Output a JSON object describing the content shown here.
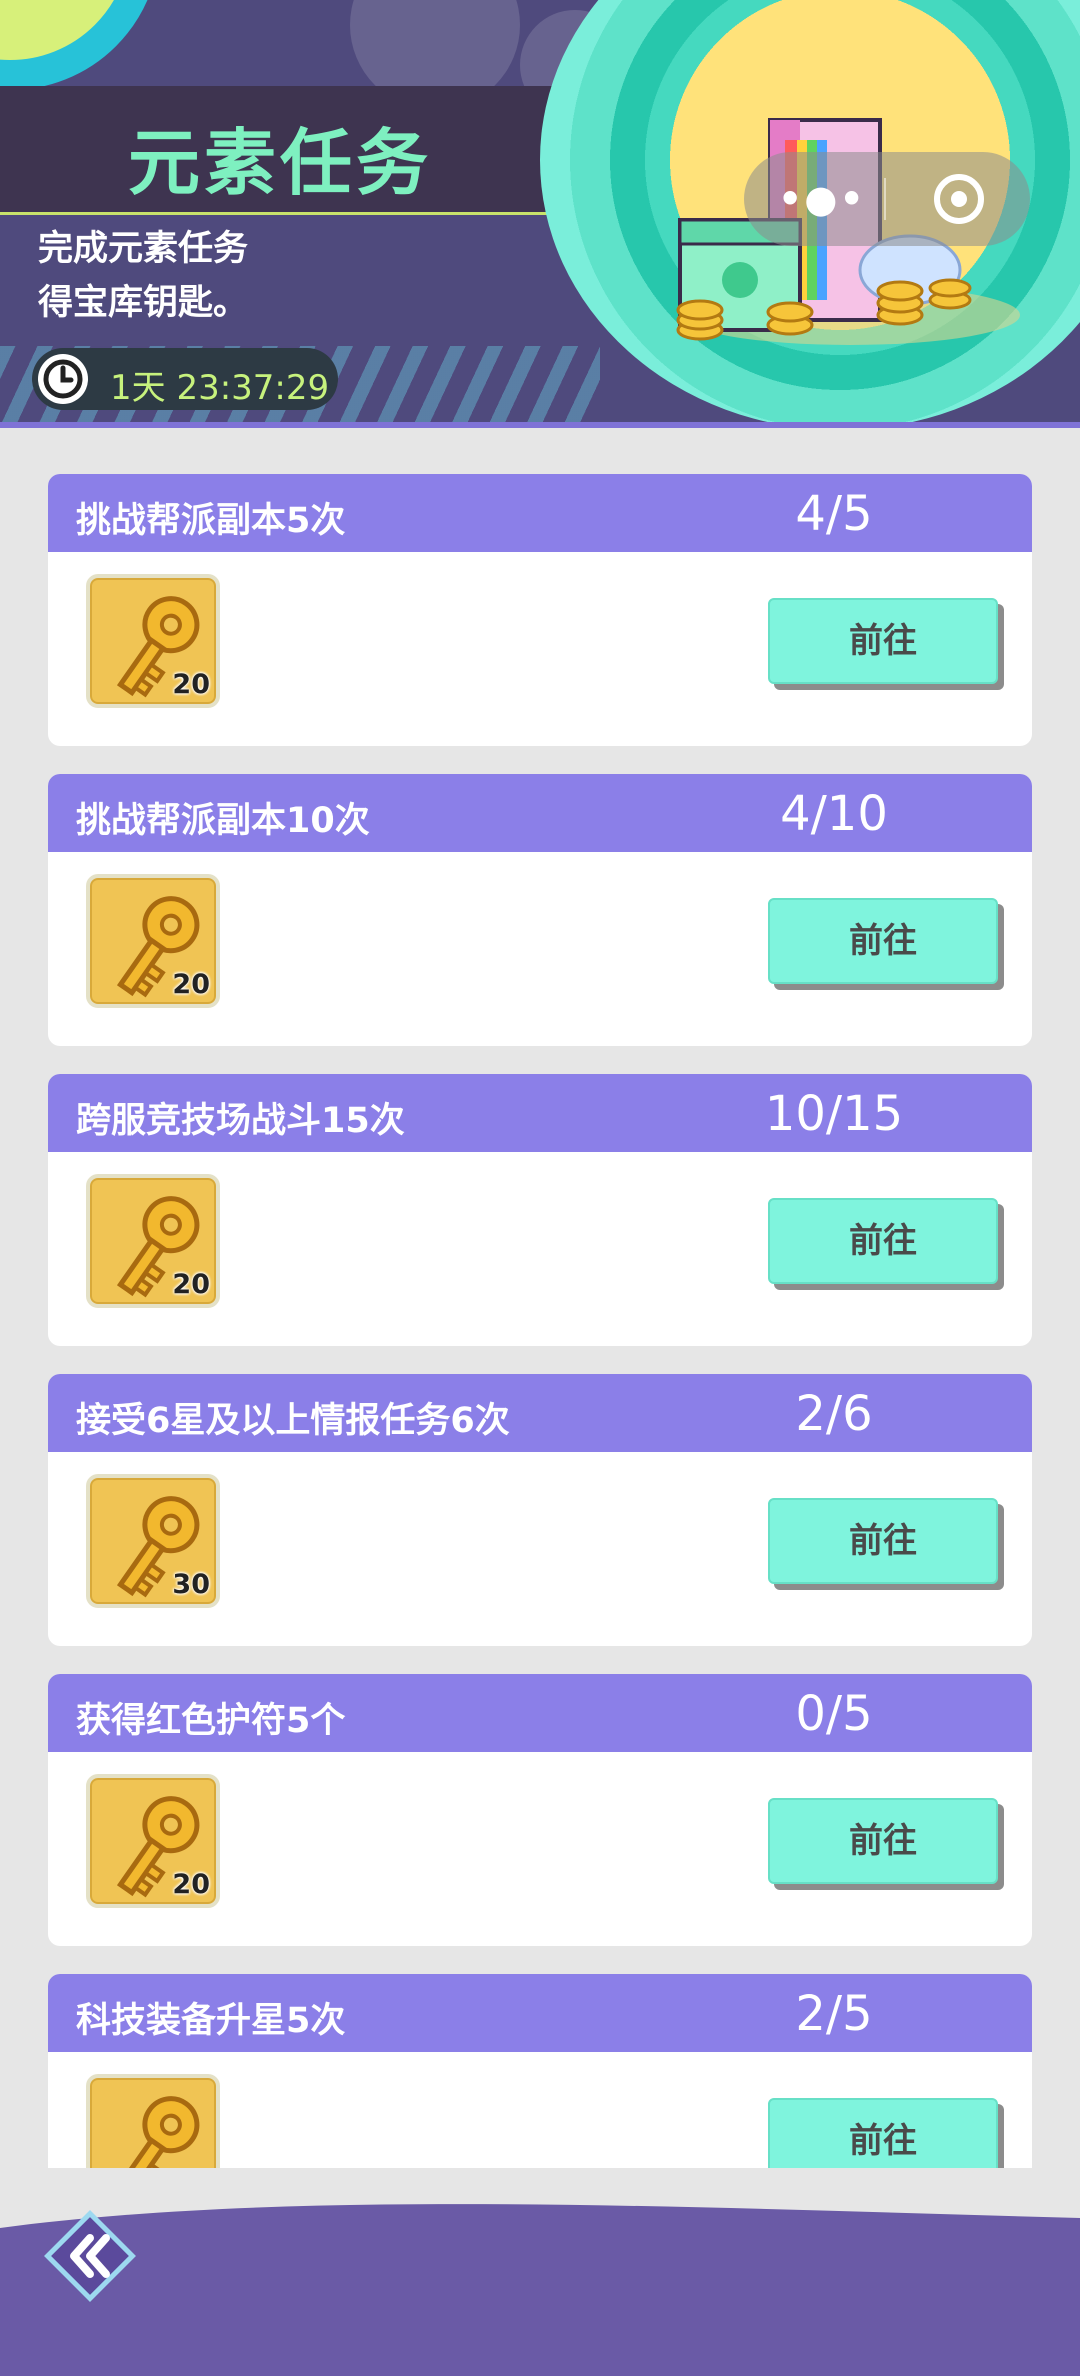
{
  "header": {
    "title": "元素任务",
    "desc_line1": "完成元素任务",
    "desc_line2": "得宝库钥匙。",
    "timer": "1天 23:37:29"
  },
  "capsule": {
    "more_icon": "more-dots-icon",
    "close_icon": "target-icon"
  },
  "tasks": [
    {
      "name": "挑战帮派副本5次",
      "progress": "4/5",
      "reward": "20",
      "button": "前往"
    },
    {
      "name": "挑战帮派副本10次",
      "progress": "4/10",
      "reward": "20",
      "button": "前往"
    },
    {
      "name": "跨服竞技场战斗15次",
      "progress": "10/15",
      "reward": "20",
      "button": "前往"
    },
    {
      "name": "接受6星及以上情报任务6次",
      "progress": "2/6",
      "reward": "30",
      "button": "前往"
    },
    {
      "name": "获得红色护符5个",
      "progress": "0/5",
      "reward": "20",
      "button": "前往"
    },
    {
      "name": "科技装备升星5次",
      "progress": "2/5",
      "reward": "",
      "button": "前往"
    }
  ],
  "colors": {
    "accent": "#8b7fe8",
    "button": "#7ff4dd",
    "title": "#7ef0c0",
    "footer": "#6a5aa6"
  }
}
